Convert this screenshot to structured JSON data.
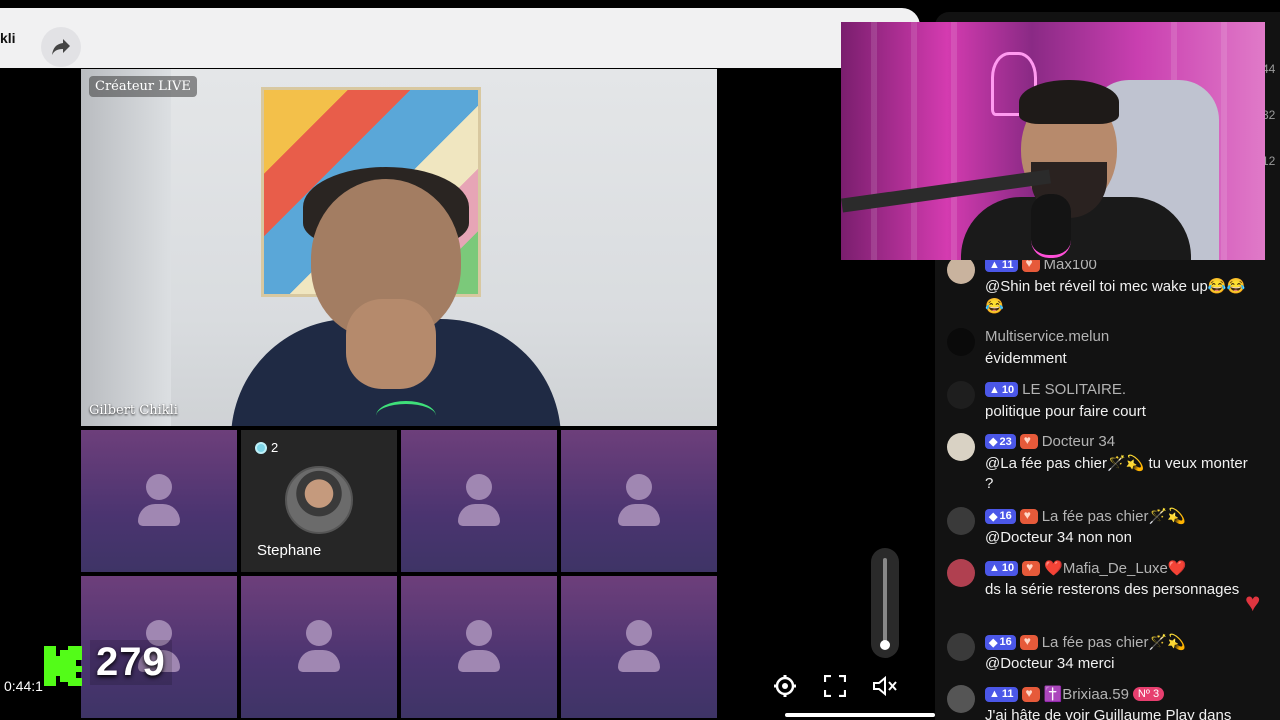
{
  "topbar": {
    "username_partial": "kli"
  },
  "main_video": {
    "creator_badge": "Créateur LIVE",
    "host_name": "Gilbert Chikli"
  },
  "guests": [
    {
      "occupied": false
    },
    {
      "occupied": true,
      "name": "Stephane",
      "badge_count": "2"
    },
    {
      "occupied": false
    },
    {
      "occupied": false
    },
    {
      "occupied": false
    },
    {
      "occupied": false
    },
    {
      "occupied": false
    },
    {
      "occupied": false
    }
  ],
  "overlay": {
    "viewer_count": "279",
    "timestamp": "0:44:1"
  },
  "side_numbers": [
    "44",
    "32",
    "12"
  ],
  "colors": {
    "accent_purple": "#4b57e8",
    "kick_green": "#53fc18",
    "heart_red": "#e0353f"
  },
  "chat": {
    "messages": [
      {
        "level": "11",
        "has_heart": true,
        "username": "Max100",
        "text": "@Shin bet réveil toi mec wake up😂😂😂"
      },
      {
        "level": "",
        "has_heart": false,
        "username": "Multiservice.melun",
        "text": "évidemment"
      },
      {
        "level": "10",
        "has_heart": false,
        "username": "LE SOLITAIRE.",
        "text": "politique pour faire court"
      },
      {
        "level": "23",
        "has_heart": true,
        "username": "Docteur 34",
        "text": "@La fée pas chier🪄💫 tu veux monter ?"
      },
      {
        "level": "16",
        "has_heart": true,
        "username": "La fée pas chier🪄💫",
        "text": "@Docteur 34 non non"
      },
      {
        "level": "10",
        "has_heart": true,
        "username": "❤️Mafia_De_Luxe❤️",
        "text": "ds la série resterons des personnages"
      },
      {
        "level": "16",
        "has_heart": true,
        "username": "La fée pas chier🪄💫",
        "text": "@Docteur 34 merci"
      },
      {
        "level": "11",
        "has_heart": true,
        "username": "✝️Brixiaa.59",
        "badge": "Nº 3",
        "text": "J'ai hâte de voir Guillaume Play dans"
      }
    ]
  }
}
